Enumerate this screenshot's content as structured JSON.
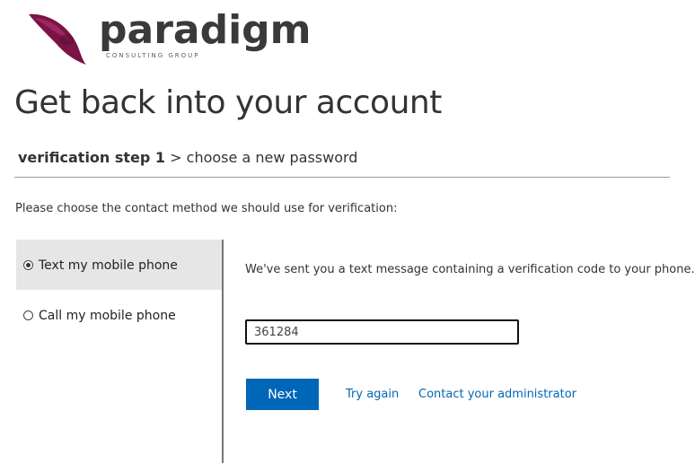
{
  "brand": {
    "name": "paradigm",
    "tagline": "CONSULTING GROUP",
    "logo_color": "#7a1446"
  },
  "page": {
    "title": "Get back into your account"
  },
  "steps": {
    "current": "verification step 1",
    "separator": ">",
    "next": "choose a new password"
  },
  "instructions": "Please choose the contact method we should use for verification:",
  "methods": [
    {
      "label": "Text my mobile phone",
      "selected": true
    },
    {
      "label": "Call my mobile phone",
      "selected": false
    }
  ],
  "verification": {
    "message": "We've sent you a text message containing a verification code to your phone.",
    "code_value": "361284"
  },
  "actions": {
    "next_label": "Next",
    "try_again_label": "Try again",
    "contact_admin_label": "Contact your administrator"
  },
  "colors": {
    "accent": "#0067b8",
    "selected_bg": "#e6e6e6"
  }
}
